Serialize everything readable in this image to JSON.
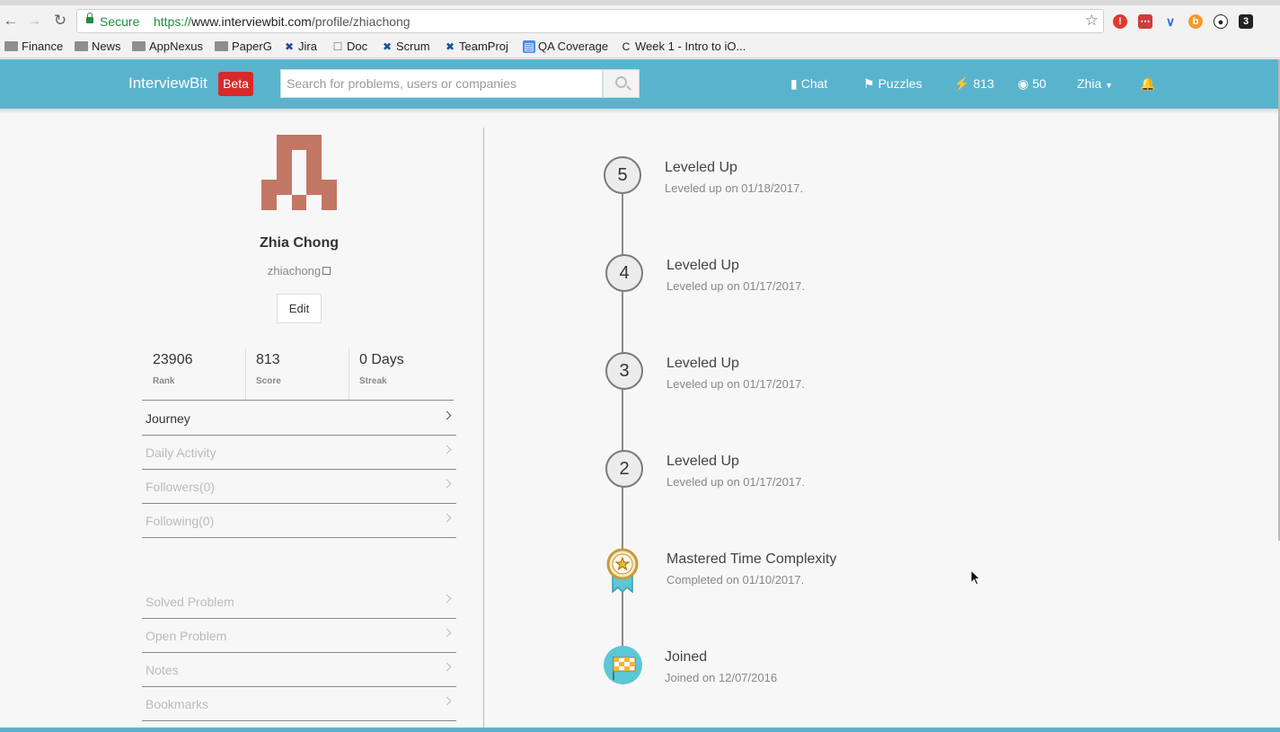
{
  "browser": {
    "secure_label": "Secure",
    "url_scheme": "https://",
    "url_domain": "www.interviewbit.com",
    "url_path": "/profile/zhiachong",
    "bookmarks": [
      "Finance",
      "News",
      "AppNexus",
      "PaperG",
      "Jira",
      "Doc",
      "Scrum",
      "TeamProj",
      "QA Coverage",
      "Week 1 - Intro to iO..."
    ],
    "extension_badge": "3"
  },
  "header": {
    "brand": "InterviewBit",
    "beta": "Beta",
    "search_placeholder": "Search for problems, users or companies",
    "chat": "Chat",
    "puzzles": "Puzzles",
    "score": "813",
    "coins": "50",
    "user": "Zhia"
  },
  "profile": {
    "name": "Zhia Chong",
    "handle": "zhiachong",
    "edit": "Edit",
    "stats": [
      {
        "value": "23906",
        "label": "Rank"
      },
      {
        "value": "813",
        "label": "Score"
      },
      {
        "value": "0 Days",
        "label": "Streak"
      }
    ],
    "menu": [
      "Journey",
      "Daily Activity",
      "Followers(0)",
      "Following(0)"
    ],
    "menu2": [
      "Solved Problem",
      "Open Problem",
      "Notes",
      "Bookmarks"
    ]
  },
  "timeline": [
    {
      "badge": "5",
      "title": "Leveled Up",
      "sub": "Leveled up on 01/18/2017."
    },
    {
      "badge": "4",
      "title": "Leveled Up",
      "sub": "Leveled up on 01/17/2017."
    },
    {
      "badge": "3",
      "title": "Leveled Up",
      "sub": "Leveled up on 01/17/2017."
    },
    {
      "badge": "2",
      "title": "Leveled Up",
      "sub": "Leveled up on 01/17/2017."
    },
    {
      "badge": "medal-icon",
      "title": "Mastered Time Complexity",
      "sub": "Completed on 01/10/2017."
    },
    {
      "badge": "checkered-flag-icon",
      "title": "Joined",
      "sub": "Joined on 12/07/2016"
    }
  ],
  "colors": {
    "header": "#5ab3cd",
    "beta": "#d62a2a",
    "avatar": "#c17764",
    "joined": "#5cc7d6"
  }
}
